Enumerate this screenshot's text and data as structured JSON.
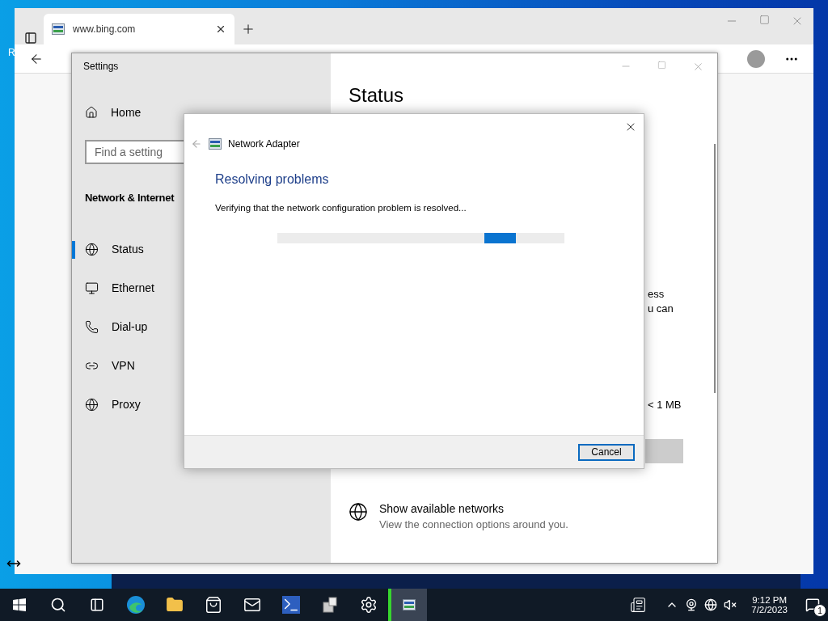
{
  "desktop": {
    "labels": [
      "R"
    ]
  },
  "browser": {
    "tab": {
      "title": "www.bing.com"
    }
  },
  "settings": {
    "title": "Settings",
    "home": "Home",
    "search": {
      "placeholder": "Find a setting"
    },
    "section": "Network & Internet",
    "nav": [
      {
        "kind": "status",
        "label": "Status",
        "selected": true
      },
      {
        "kind": "ethernet",
        "label": "Ethernet",
        "selected": false
      },
      {
        "kind": "dialup",
        "label": "Dial-up",
        "selected": false
      },
      {
        "kind": "vpn",
        "label": "VPN",
        "selected": false
      },
      {
        "kind": "proxy",
        "label": "Proxy",
        "selected": false
      }
    ],
    "heading": "Status",
    "fragments": [
      "ess",
      "u can",
      "< 1 MB"
    ],
    "link": {
      "title": "Show available networks",
      "subtitle": "View the connection options around you."
    }
  },
  "dialog": {
    "title": "Network Adapter",
    "heading": "Resolving problems",
    "message": "Verifying that the network configuration problem is resolved...",
    "buttons": [
      "Cancel"
    ]
  },
  "taskbar": {
    "apps": [
      {
        "kind": "edge",
        "active": false
      },
      {
        "kind": "explorer",
        "active": false
      },
      {
        "kind": "store",
        "active": false
      },
      {
        "kind": "mail",
        "active": false
      },
      {
        "kind": "powershell",
        "active": false
      },
      {
        "kind": "installer",
        "active": false
      },
      {
        "kind": "settings",
        "active": false
      },
      {
        "kind": "troubleshooter",
        "active": true
      }
    ],
    "time": "9:12 PM",
    "date": "7/2/2023",
    "notifications": "1"
  }
}
